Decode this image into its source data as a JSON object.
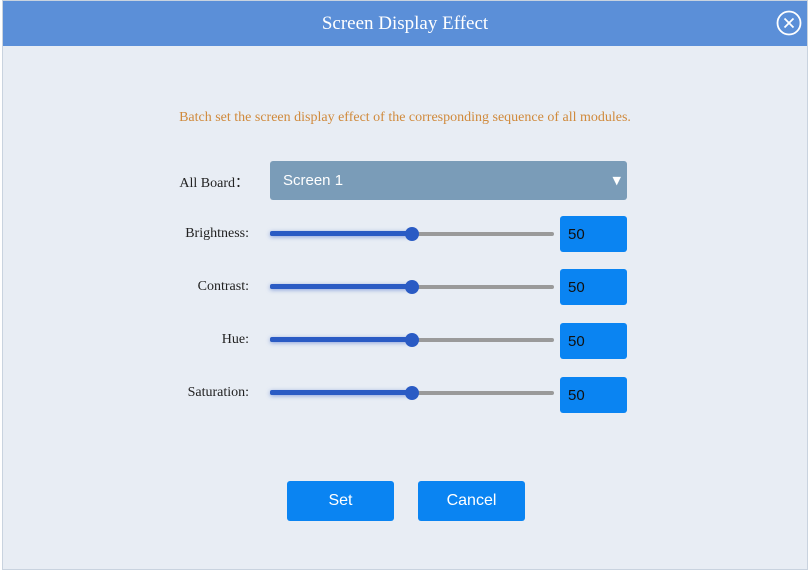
{
  "dialog": {
    "title": "Screen Display Effect",
    "close_icon": "close-circle-icon"
  },
  "description": "Batch set the screen display effect of the corresponding sequence of all modules.",
  "board": {
    "label": "All Board：",
    "selected": "Screen 1",
    "arrow_icon": "caret-down-icon"
  },
  "sliders": [
    {
      "label": "Brightness:",
      "value": "50",
      "level": 0.5
    },
    {
      "label": "Contrast:",
      "value": "50",
      "level": 0.5
    },
    {
      "label": "Hue:",
      "value": "50",
      "level": 0.5
    },
    {
      "label": "Saturation:",
      "value": "50",
      "level": 0.5
    }
  ],
  "buttons": {
    "set": "Set",
    "cancel": "Cancel"
  },
  "colors": {
    "title_bar": "#5b8fd8",
    "background": "#e8edf4",
    "accent": "#0a84f2",
    "description": "#d08a3c",
    "select_bg": "#7a9cb8"
  }
}
